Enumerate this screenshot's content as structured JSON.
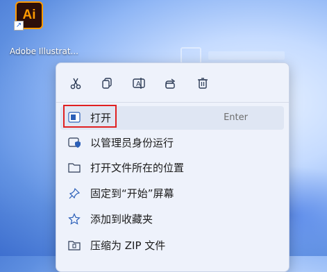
{
  "desktop": {
    "icon": {
      "logo_text": "Ai",
      "label": "Adobe Illustrat..."
    }
  },
  "toolbar": {
    "buttons": [
      {
        "name": "cut",
        "icon": "scissors-icon"
      },
      {
        "name": "copy",
        "icon": "copy-icon"
      },
      {
        "name": "rename",
        "icon": "rename-icon"
      },
      {
        "name": "share",
        "icon": "share-icon"
      },
      {
        "name": "delete",
        "icon": "trash-icon"
      }
    ]
  },
  "menu": {
    "items": [
      {
        "label": "打开",
        "shortcut": "Enter",
        "icon": "open-icon"
      },
      {
        "label": "以管理员身份运行",
        "icon": "shield-icon"
      },
      {
        "label": "打开文件所在的位置",
        "icon": "folder-icon"
      },
      {
        "label": "固定到“开始”屏幕",
        "icon": "pin-icon"
      },
      {
        "label": "添加到收藏夹",
        "icon": "star-icon"
      },
      {
        "label": "压缩为 ZIP 文件",
        "icon": "zip-icon"
      }
    ]
  },
  "colors": {
    "highlight_border": "#e02020",
    "accent": "#2b5fb8"
  }
}
